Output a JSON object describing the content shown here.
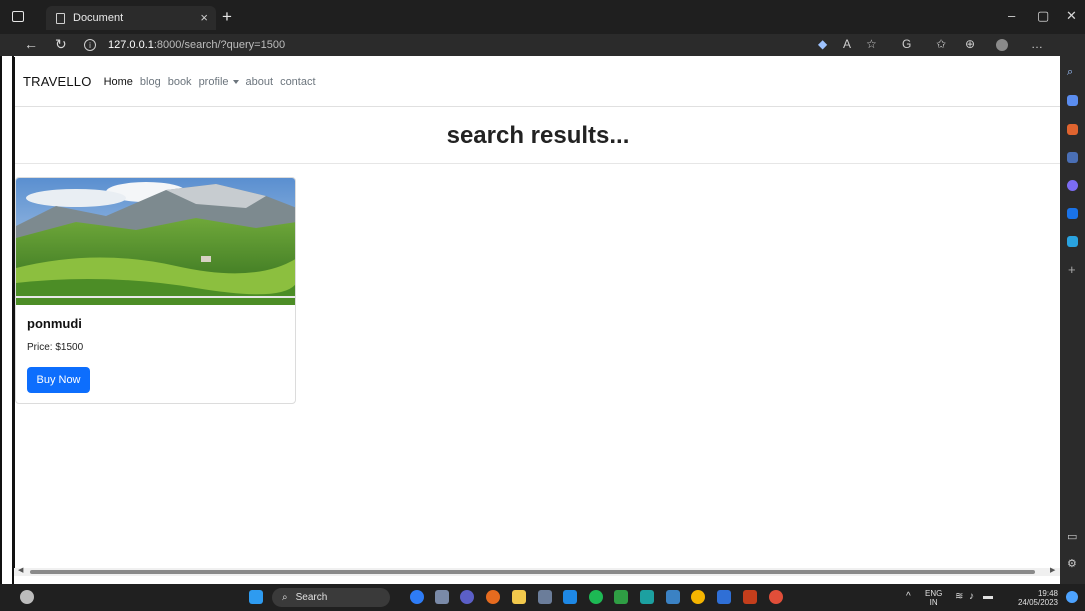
{
  "browser": {
    "tab_title": "Document",
    "url_host": "127.0.0.1",
    "url_rest": ":8000/search/?query=1500",
    "bing_label": "b"
  },
  "navbar": {
    "brand": "TRAVELLO",
    "links": [
      "Home",
      "blog",
      "book",
      "profile",
      "about",
      "contact"
    ]
  },
  "results": {
    "heading": "search results..."
  },
  "card": {
    "title": "ponmudi",
    "price": "Price: $1500",
    "button": "Buy Now"
  },
  "taskbar": {
    "search_label": "Search",
    "lang_top": "ENG",
    "lang_bottom": "IN",
    "time": "19:48",
    "date": "24/05/2023"
  },
  "colors": {
    "primary_button": "#0d6efd",
    "chrome_dark": "#202020"
  }
}
